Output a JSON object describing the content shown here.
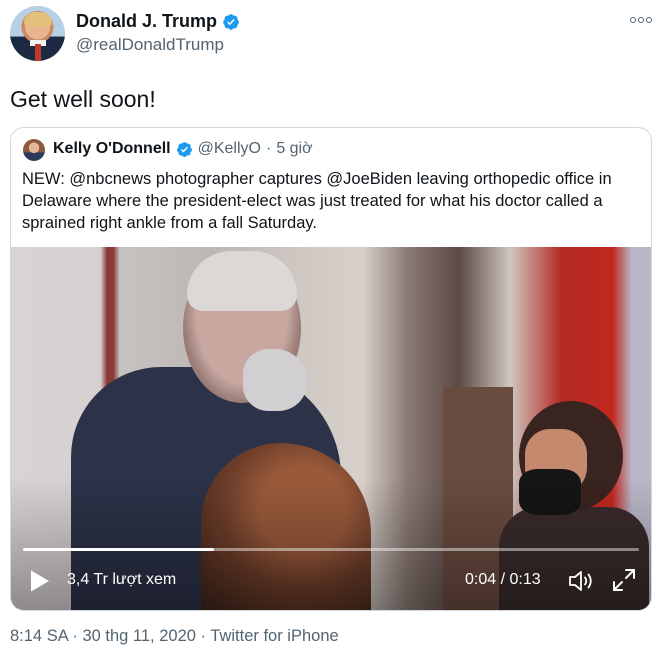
{
  "author": {
    "display_name": "Donald J. Trump",
    "handle": "@realDonaldTrump",
    "avatar_icon": "profile-photo",
    "verified_icon": "verified-badge-icon"
  },
  "menu_icon": "more-options-icon",
  "tweet": {
    "text": "Get well soon!"
  },
  "quoted": {
    "display_name": "Kelly O'Donnell",
    "handle": "@KellyO",
    "separator": "·",
    "time": "5 giờ",
    "text": "NEW:  @nbcnews photographer captures @JoeBiden leaving orthopedic office in Delaware where the president-elect was just treated for what his doctor called a sprained right ankle from a fall Saturday.",
    "video": {
      "views": "3,4 Tr lượt xem",
      "time": "0:04 / 0:13",
      "progress": 0.31,
      "play_icon": "play-icon",
      "volume_icon": "volume-icon",
      "fullscreen_icon": "fullscreen-icon"
    }
  },
  "footer": {
    "meta": "8:14 SA · 30 thg 11, 2020 · Twitter for iPhone"
  },
  "colors": {
    "verified": "#1d9bf0",
    "secondary_text": "#536471",
    "border": "#cfd9de"
  }
}
